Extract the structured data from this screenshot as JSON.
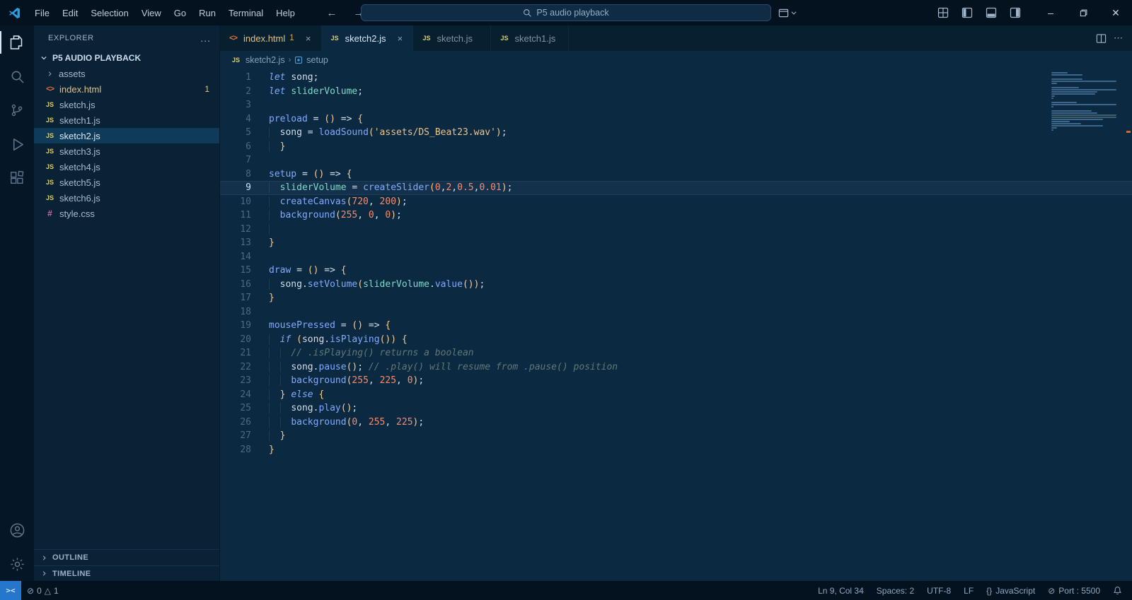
{
  "titlebar": {
    "menus": [
      "File",
      "Edit",
      "Selection",
      "View",
      "Go",
      "Run",
      "Terminal",
      "Help"
    ],
    "search_label": "P5 audio playback"
  },
  "activitybar": {
    "items": [
      {
        "id": "explorer",
        "active": true
      },
      {
        "id": "search",
        "active": false
      },
      {
        "id": "source-control",
        "active": false
      },
      {
        "id": "run-debug",
        "active": false
      },
      {
        "id": "extensions",
        "active": false
      }
    ],
    "bottom": [
      {
        "id": "account",
        "active": false
      },
      {
        "id": "settings",
        "active": false
      }
    ]
  },
  "sidebar": {
    "title": "EXPLORER",
    "more_label": "...",
    "root": "P5 AUDIO PLAYBACK",
    "items": [
      {
        "label": "assets",
        "type": "folder"
      },
      {
        "label": "index.html",
        "type": "html",
        "badge": "1",
        "modified": true
      },
      {
        "label": "sketch.js",
        "type": "js"
      },
      {
        "label": "sketch1.js",
        "type": "js"
      },
      {
        "label": "sketch2.js",
        "type": "js",
        "selected": true
      },
      {
        "label": "sketch3.js",
        "type": "js"
      },
      {
        "label": "sketch4.js",
        "type": "js"
      },
      {
        "label": "sketch5.js",
        "type": "js"
      },
      {
        "label": "sketch6.js",
        "type": "js"
      },
      {
        "label": "style.css",
        "type": "css"
      }
    ],
    "sections": [
      "OUTLINE",
      "TIMELINE"
    ]
  },
  "editor": {
    "tabs": [
      {
        "label": "index.html",
        "icon": "html",
        "badge": "1",
        "close": true,
        "modified": true,
        "active": false
      },
      {
        "label": "sketch2.js",
        "icon": "js",
        "close": true,
        "active": true
      },
      {
        "label": "sketch.js",
        "icon": "js",
        "active": false
      },
      {
        "label": "sketch1.js",
        "icon": "js",
        "active": false
      }
    ],
    "breadcrumb": {
      "file": "sketch2.js",
      "symbol": "setup"
    },
    "code": {
      "active_line": 9,
      "lines": [
        [
          {
            "t": "let ",
            "c": "kw"
          },
          {
            "t": "song",
            "c": "df"
          },
          {
            "t": ";",
            "c": "pn"
          }
        ],
        [
          {
            "t": "let ",
            "c": "kw"
          },
          {
            "t": "sliderVolume",
            "c": "cy"
          },
          {
            "t": ";",
            "c": "pn"
          }
        ],
        [],
        [
          {
            "t": "preload",
            "c": "fn"
          },
          {
            "t": " = ",
            "c": "pn"
          },
          {
            "t": "()",
            "c": "br"
          },
          {
            "t": " => ",
            "c": "pn"
          },
          {
            "t": "{",
            "c": "br"
          }
        ],
        [
          {
            "t": "  ",
            "c": "ws"
          },
          {
            "t": "song",
            "c": "df"
          },
          {
            "t": " = ",
            "c": "pn"
          },
          {
            "t": "loadSound",
            "c": "fn"
          },
          {
            "t": "(",
            "c": "br"
          },
          {
            "t": "'assets/DS_Beat23.wav'",
            "c": "str"
          },
          {
            "t": ")",
            "c": "br"
          },
          {
            "t": ";",
            "c": "pn"
          }
        ],
        [
          {
            "t": "  ",
            "c": "ws"
          },
          {
            "t": "}",
            "c": "br"
          }
        ],
        [],
        [
          {
            "t": "setup",
            "c": "fn"
          },
          {
            "t": " = ",
            "c": "pn"
          },
          {
            "t": "()",
            "c": "br"
          },
          {
            "t": " => ",
            "c": "pn"
          },
          {
            "t": "{",
            "c": "br"
          }
        ],
        [
          {
            "t": "  ",
            "c": "ws"
          },
          {
            "t": "sliderVolume",
            "c": "cy"
          },
          {
            "t": " = ",
            "c": "pn"
          },
          {
            "t": "createSlider",
            "c": "fn"
          },
          {
            "t": "(",
            "c": "br"
          },
          {
            "t": "0",
            "c": "num"
          },
          {
            "t": ",",
            "c": "pn"
          },
          {
            "t": "2",
            "c": "num"
          },
          {
            "t": ",",
            "c": "pn"
          },
          {
            "t": "0.5",
            "c": "num"
          },
          {
            "t": ",",
            "c": "pn"
          },
          {
            "t": "0.01",
            "c": "num"
          },
          {
            "t": ")",
            "c": "br"
          },
          {
            "t": ";",
            "c": "pn"
          }
        ],
        [
          {
            "t": "  ",
            "c": "ws"
          },
          {
            "t": "createCanvas",
            "c": "fn"
          },
          {
            "t": "(",
            "c": "br"
          },
          {
            "t": "720",
            "c": "num"
          },
          {
            "t": ", ",
            "c": "pn"
          },
          {
            "t": "200",
            "c": "num"
          },
          {
            "t": ")",
            "c": "br"
          },
          {
            "t": ";",
            "c": "pn"
          }
        ],
        [
          {
            "t": "  ",
            "c": "ws"
          },
          {
            "t": "background",
            "c": "fn"
          },
          {
            "t": "(",
            "c": "br"
          },
          {
            "t": "255",
            "c": "num"
          },
          {
            "t": ", ",
            "c": "pn"
          },
          {
            "t": "0",
            "c": "num"
          },
          {
            "t": ", ",
            "c": "pn"
          },
          {
            "t": "0",
            "c": "num"
          },
          {
            "t": ")",
            "c": "br"
          },
          {
            "t": ";",
            "c": "pn"
          }
        ],
        [
          {
            "t": "  ",
            "c": "ws"
          }
        ],
        [
          {
            "t": "}",
            "c": "br"
          }
        ],
        [],
        [
          {
            "t": "draw",
            "c": "fn"
          },
          {
            "t": " = ",
            "c": "pn"
          },
          {
            "t": "()",
            "c": "br"
          },
          {
            "t": " => ",
            "c": "pn"
          },
          {
            "t": "{",
            "c": "br"
          }
        ],
        [
          {
            "t": "  ",
            "c": "ws"
          },
          {
            "t": "song",
            "c": "df"
          },
          {
            "t": ".",
            "c": "pn"
          },
          {
            "t": "setVolume",
            "c": "fn"
          },
          {
            "t": "(",
            "c": "br"
          },
          {
            "t": "sliderVolume",
            "c": "cy"
          },
          {
            "t": ".",
            "c": "pn"
          },
          {
            "t": "value",
            "c": "fn"
          },
          {
            "t": "())",
            "c": "br"
          },
          {
            "t": ";",
            "c": "pn"
          }
        ],
        [
          {
            "t": "}",
            "c": "br"
          }
        ],
        [],
        [
          {
            "t": "mousePressed",
            "c": "fn"
          },
          {
            "t": " = ",
            "c": "pn"
          },
          {
            "t": "()",
            "c": "br"
          },
          {
            "t": " => ",
            "c": "pn"
          },
          {
            "t": "{",
            "c": "br"
          }
        ],
        [
          {
            "t": "  ",
            "c": "ws"
          },
          {
            "t": "if ",
            "c": "kw"
          },
          {
            "t": "(",
            "c": "br"
          },
          {
            "t": "song",
            "c": "df"
          },
          {
            "t": ".",
            "c": "pn"
          },
          {
            "t": "isPlaying",
            "c": "fn"
          },
          {
            "t": "())",
            "c": "br"
          },
          {
            "t": " ",
            "c": "pn"
          },
          {
            "t": "{",
            "c": "br"
          }
        ],
        [
          {
            "t": "    ",
            "c": "ws"
          },
          {
            "t": "// .isPlaying() returns a boolean",
            "c": "cm"
          }
        ],
        [
          {
            "t": "    ",
            "c": "ws"
          },
          {
            "t": "song",
            "c": "df"
          },
          {
            "t": ".",
            "c": "pn"
          },
          {
            "t": "pause",
            "c": "fn"
          },
          {
            "t": "()",
            "c": "br"
          },
          {
            "t": "; ",
            "c": "pn"
          },
          {
            "t": "// .play() will resume from .pause() position",
            "c": "cm"
          }
        ],
        [
          {
            "t": "    ",
            "c": "ws"
          },
          {
            "t": "background",
            "c": "fn"
          },
          {
            "t": "(",
            "c": "br"
          },
          {
            "t": "255",
            "c": "num"
          },
          {
            "t": ", ",
            "c": "pn"
          },
          {
            "t": "225",
            "c": "num"
          },
          {
            "t": ", ",
            "c": "pn"
          },
          {
            "t": "0",
            "c": "num"
          },
          {
            "t": ")",
            "c": "br"
          },
          {
            "t": ";",
            "c": "pn"
          }
        ],
        [
          {
            "t": "  ",
            "c": "ws"
          },
          {
            "t": "} ",
            "c": "br"
          },
          {
            "t": "else",
            "c": "kw"
          },
          {
            "t": " ",
            "c": "pn"
          },
          {
            "t": "{",
            "c": "br"
          }
        ],
        [
          {
            "t": "    ",
            "c": "ws"
          },
          {
            "t": "song",
            "c": "df"
          },
          {
            "t": ".",
            "c": "pn"
          },
          {
            "t": "play",
            "c": "fn"
          },
          {
            "t": "()",
            "c": "br"
          },
          {
            "t": ";",
            "c": "pn"
          }
        ],
        [
          {
            "t": "    ",
            "c": "ws"
          },
          {
            "t": "background",
            "c": "fn"
          },
          {
            "t": "(",
            "c": "br"
          },
          {
            "t": "0",
            "c": "num"
          },
          {
            "t": ", ",
            "c": "pn"
          },
          {
            "t": "255",
            "c": "num"
          },
          {
            "t": ", ",
            "c": "pn"
          },
          {
            "t": "225",
            "c": "num"
          },
          {
            "t": ")",
            "c": "br"
          },
          {
            "t": ";",
            "c": "pn"
          }
        ],
        [
          {
            "t": "  ",
            "c": "ws"
          },
          {
            "t": "}",
            "c": "br"
          }
        ],
        [
          {
            "t": "}",
            "c": "br"
          }
        ]
      ]
    }
  },
  "statusbar": {
    "remote": "><",
    "errors": "0",
    "warnings": "1",
    "cursor": "Ln 9, Col 34",
    "indentation": "Spaces: 2",
    "encoding": "UTF-8",
    "eol": "LF",
    "language": "JavaScript",
    "language_icon": "{}",
    "port": "Port : 5500"
  }
}
